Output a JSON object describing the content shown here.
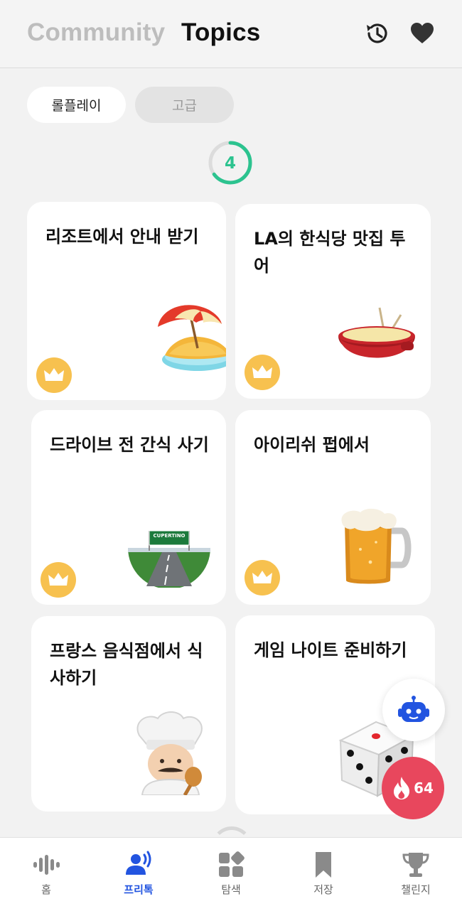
{
  "header": {
    "tab_community": "Community",
    "tab_topics": "Topics",
    "history_icon": "history-icon",
    "heart_icon": "heart-icon"
  },
  "level_tabs": {
    "roleplay": "롤플레이",
    "advanced": "고급"
  },
  "progress": {
    "count": "4",
    "fraction": 0.65
  },
  "cards": [
    {
      "title": "리조트에서 안내 받기",
      "icon": "beach-umbrella-island-emoji",
      "premium": true
    },
    {
      "title": "LA의 한식당 맛집 투어",
      "icon": "fondue-pot-emoji",
      "premium": true
    },
    {
      "title": "드라이브 전 간식 사기",
      "icon": "highway-road-emoji",
      "sign_text": "CUPERTINO",
      "premium": true
    },
    {
      "title": "아이리쉬 펍에서",
      "icon": "beer-mug-emoji",
      "premium": true
    },
    {
      "title": "프랑스 음식점에서 식사하기",
      "icon": "chef-emoji",
      "premium": false
    },
    {
      "title": "게임 나이트 준비하기",
      "icon": "dice-emoji",
      "premium": false
    }
  ],
  "fab": {
    "bot_icon": "robot-icon",
    "streak_icon": "flame-icon",
    "streak_count": "64"
  },
  "colors": {
    "accent_blue": "#2254e0",
    "crown_yellow": "#f7c14f",
    "progress_green": "#2cc38f",
    "streak_red": "#e8475d"
  },
  "bottom_nav": [
    {
      "label": "홈",
      "icon": "waveform-icon",
      "active": false
    },
    {
      "label": "프리톡",
      "icon": "person-speaking-icon",
      "active": true
    },
    {
      "label": "탐색",
      "icon": "grid-icon",
      "active": false
    },
    {
      "label": "저장",
      "icon": "bookmark-icon",
      "active": false
    },
    {
      "label": "챌린지",
      "icon": "trophy-icon",
      "active": false
    }
  ]
}
